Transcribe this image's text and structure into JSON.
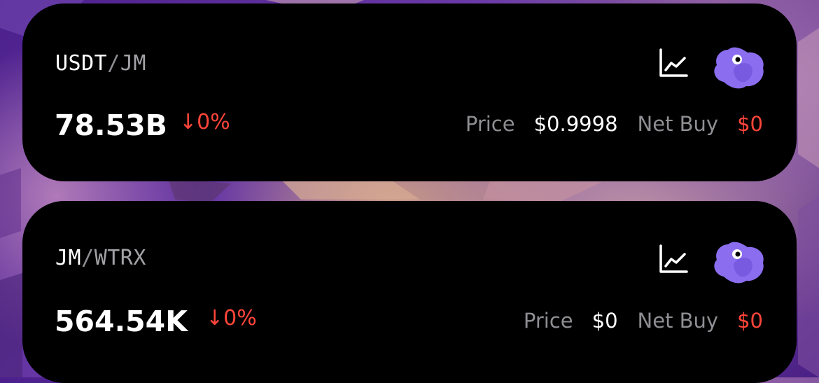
{
  "colors": {
    "card_bg": "#000000",
    "negative": "#ff453a",
    "muted": "#8e8e93",
    "logo_purple": "#8b6df0"
  },
  "icons": {
    "chart": "line-chart-icon",
    "logo": "token-logo-icon"
  },
  "pairs": [
    {
      "base": "USDT",
      "separator": "/",
      "quote": "JM",
      "amount": "78.53B",
      "change": "↓0%",
      "price_label": "Price",
      "price": "$0.9998",
      "net_buy_label": "Net Buy",
      "net_buy": "$0"
    },
    {
      "base": "JM",
      "separator": "/",
      "quote": "WTRX",
      "amount": "564.54K",
      "change": "↓0%",
      "price_label": "Price",
      "price": "$0",
      "net_buy_label": "Net Buy",
      "net_buy": "$0"
    }
  ]
}
